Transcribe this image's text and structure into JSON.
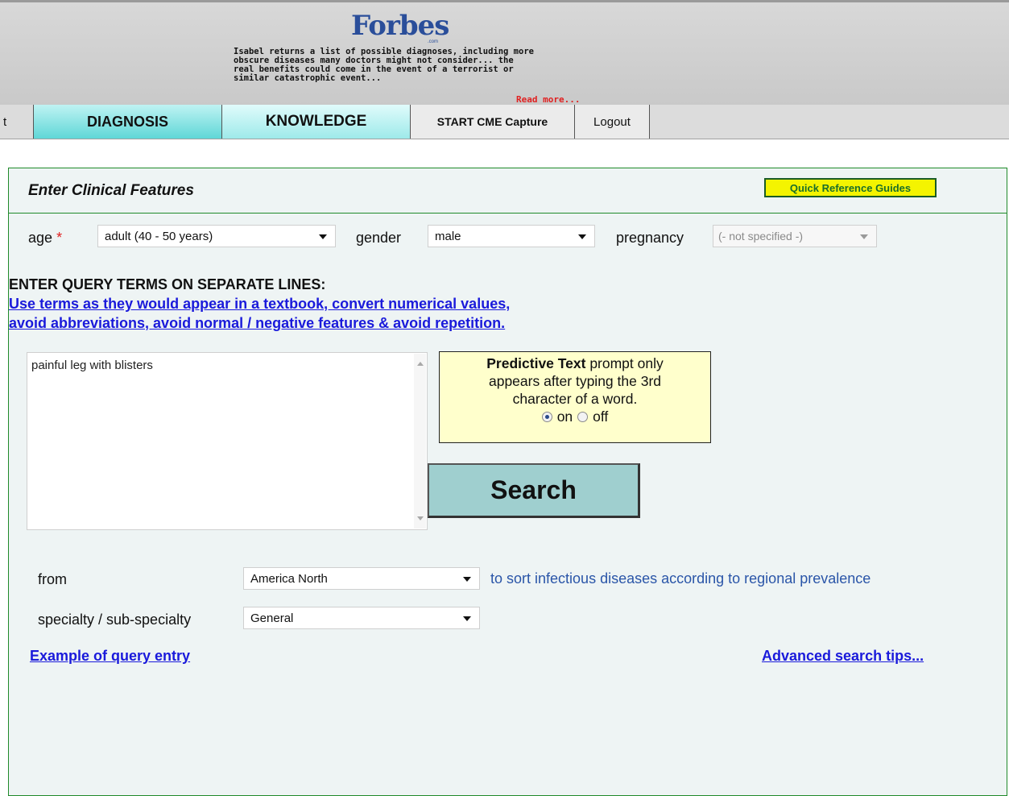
{
  "banner": {
    "logo_text": "Forbes",
    "logo_suffix": ".com",
    "quote_lines": [
      "Isabel returns a list of possible diagnoses, including more",
      "obscure diseases many doctors might not consider... the",
      "real benefits could come in the event of a terrorist or",
      "similar catastrophic event..."
    ],
    "read_more": "Read more..."
  },
  "nav": {
    "cut_item": "t",
    "diagnosis": "DIAGNOSIS",
    "knowledge": "KNOWLEDGE",
    "cme": "START CME Capture",
    "logout": "Logout"
  },
  "panel": {
    "title": "Enter Clinical Features",
    "quick_ref": "Quick Reference Guides"
  },
  "demographics": {
    "age_label": "age",
    "age_required": "*",
    "age_value": "adult (40 - 50 years)",
    "gender_label": "gender",
    "gender_value": "male",
    "pregnancy_label": "pregnancy",
    "pregnancy_value": "(- not specified -)"
  },
  "query": {
    "heading": "ENTER QUERY TERMS ON SEPARATE LINES:",
    "hint_line1": "Use terms as they would appear in a textbook, convert numerical values,",
    "hint_line2": "avoid abbreviations, avoid normal / negative features & avoid repetition.",
    "value": "painful leg with blisters"
  },
  "predictive": {
    "bold": "Predictive Text",
    "line1_rest": " prompt only",
    "line2": "appears after typing the 3rd",
    "line3": "character of a word.",
    "on_label": "on",
    "off_label": "off",
    "selected": "on"
  },
  "search_button": "Search",
  "filters": {
    "from_label": "from",
    "from_value": "America North",
    "from_hint": "to sort infectious diseases according to regional prevalence",
    "specialty_label": "specialty / sub-specialty",
    "specialty_value": "General"
  },
  "links": {
    "example": "Example of query entry",
    "advanced": "Advanced search tips..."
  },
  "colors": {
    "panel_border": "#1f8a2a",
    "panel_bg": "#eef4f4",
    "link": "#1a1adb",
    "required": "#e02020",
    "nav_active": "#5fd7d7",
    "quick_ref_bg": "#f4f400"
  }
}
